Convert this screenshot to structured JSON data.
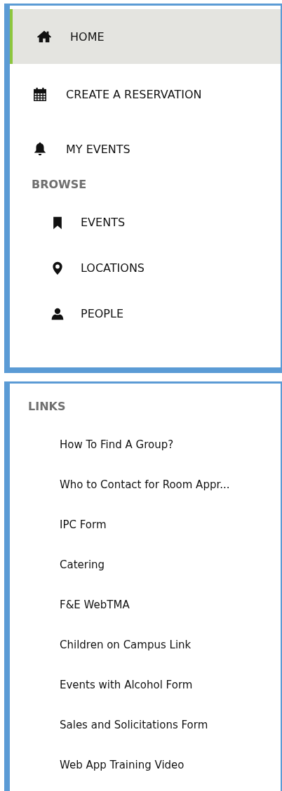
{
  "nav": {
    "items": [
      {
        "label": "HOME",
        "selected": true
      },
      {
        "label": "CREATE A RESERVATION",
        "selected": false
      },
      {
        "label": "MY EVENTS",
        "selected": false
      }
    ]
  },
  "browse": {
    "heading": "BROWSE",
    "items": [
      {
        "label": "EVENTS"
      },
      {
        "label": "LOCATIONS"
      },
      {
        "label": "PEOPLE"
      }
    ]
  },
  "links": {
    "heading": "LINKS",
    "items": [
      "How To Find A Group?",
      "Who to Contact for Room Appr...",
      "IPC Form",
      "Catering",
      "F&E WebTMA",
      "Children on Campus Link",
      "Events with Alcohol Form",
      "Sales and Solicitations Form",
      "Web App Training Video"
    ]
  }
}
